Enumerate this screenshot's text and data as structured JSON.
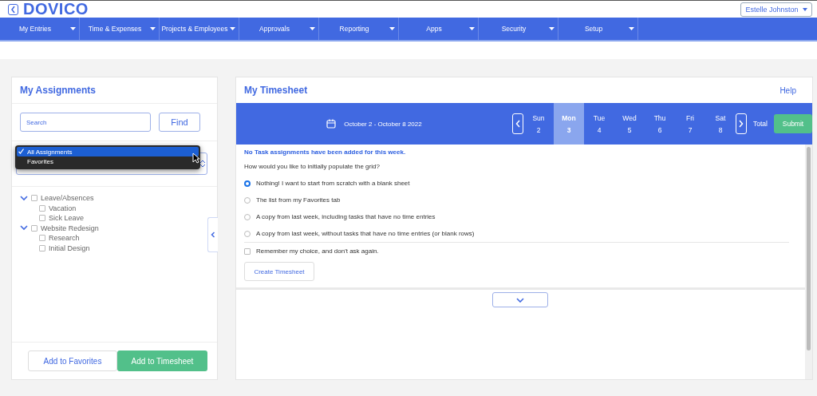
{
  "header": {
    "logo": "DOVICO",
    "user": "Estelle Johnston"
  },
  "nav": [
    "My Entries",
    "Time & Expenses",
    "Projects & Employees",
    "Approvals",
    "Reporting",
    "Apps",
    "Security",
    "Setup"
  ],
  "assignments": {
    "title": "My Assignments",
    "search": {
      "placeholder": "Search"
    },
    "find": "Find",
    "filter_options": [
      {
        "label": "All Assignments",
        "selected": true
      },
      {
        "label": "Favorites",
        "selected": false
      }
    ],
    "tree": [
      {
        "label": "Leave/Absences",
        "expanded": true,
        "checked": false,
        "children": [
          {
            "label": "Vacation",
            "checked": false
          },
          {
            "label": "Sick Leave",
            "checked": false
          }
        ]
      },
      {
        "label": "Website Redesign",
        "expanded": true,
        "checked": false,
        "children": [
          {
            "label": "Research",
            "checked": false
          },
          {
            "label": "Initial Design",
            "checked": false
          }
        ]
      }
    ],
    "buttons": [
      "Add to Favorites",
      "Add to Timesheet"
    ]
  },
  "timesheet": {
    "title": "My Timesheet",
    "help": "Help",
    "range": "October 2 - October 8 2022",
    "days": [
      {
        "name": "Sun",
        "date": "2",
        "selected": false
      },
      {
        "name": "Mon",
        "date": "3",
        "selected": true
      },
      {
        "name": "Tue",
        "date": "4",
        "selected": false
      },
      {
        "name": "Wed",
        "date": "5",
        "selected": false
      },
      {
        "name": "Thu",
        "date": "6",
        "selected": false
      },
      {
        "name": "Fri",
        "date": "7",
        "selected": false
      },
      {
        "name": "Sat",
        "date": "8",
        "selected": false
      }
    ],
    "total": "Total",
    "submit": "Submit",
    "notice": "No Task assignments have been added for this week.",
    "question": "How would you like to initially populate the grid?",
    "options": [
      {
        "label": "Nothing! I want to start from scratch with a blank sheet",
        "selected": true
      },
      {
        "label": "The list from my Favorites tab",
        "selected": false
      },
      {
        "label": "A copy from last week, including tasks that have no time entries",
        "selected": false
      },
      {
        "label": "A copy from last week, without tasks that have no time entries (or blank rows)",
        "selected": false
      }
    ],
    "remember": {
      "label": "Remember my choice, and don't ask again.",
      "checked": false
    },
    "create": "Create Timesheet"
  }
}
